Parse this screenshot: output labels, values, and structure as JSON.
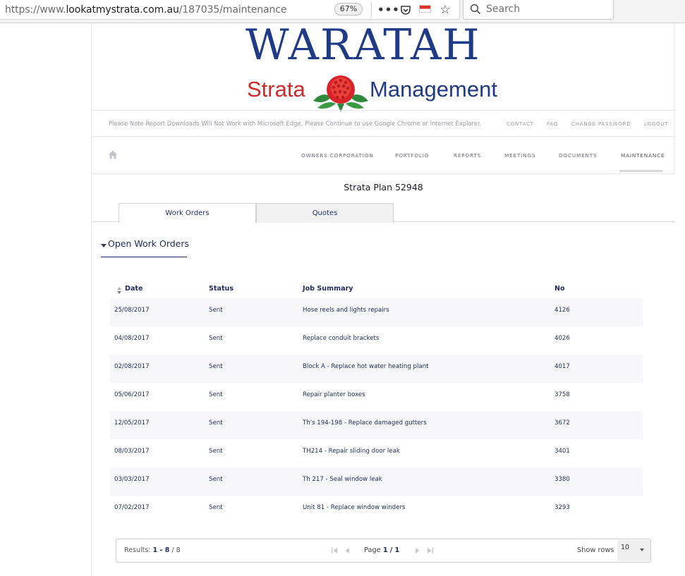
{
  "browser": {
    "url_prefix": "https://www.",
    "url_domain": "lookatmystrata.com.au",
    "url_path": "/187035/maintenance",
    "zoom": "67%",
    "more_glyph": "•••",
    "search_placeholder": "Search"
  },
  "logo": {
    "title": "WARATAH",
    "word_left": "Strata",
    "word_right": "Management"
  },
  "notice": "Please Note Report Downloads Will Not Work with Microsoft Edge, Please Continue to use Google Chrome or Internet Explorer.",
  "top_links": {
    "contact": "CONTACT",
    "faq": "FAQ",
    "change_password": "CHANGE PASSWORD",
    "logout": "LOGOUT"
  },
  "nav": {
    "owners_corporation": "OWNERS CORPORATION",
    "portfolio": "PORTFOLIO",
    "reports": "REPORTS",
    "meetings": "MEETINGS",
    "documents": "DOCUMENTS",
    "maintenance": "MAINTENANCE"
  },
  "strata_title": "Strata Plan 52948",
  "tabs": {
    "work_orders": "Work Orders",
    "quotes": "Quotes"
  },
  "section_title": "Open Work Orders",
  "table": {
    "headers": {
      "date": "Date",
      "status": "Status",
      "job_summary": "Job Summary",
      "no": "No"
    },
    "rows": [
      {
        "date": "25/08/2017",
        "status": "Sent",
        "job": "Hose reels and lights repairs",
        "no": "4126"
      },
      {
        "date": "04/08/2017",
        "status": "Sent",
        "job": "Replace conduit brackets",
        "no": "4026"
      },
      {
        "date": "02/08/2017",
        "status": "Sent",
        "job": "Block A - Replace hot water heating plant",
        "no": "4017"
      },
      {
        "date": "05/06/2017",
        "status": "Sent",
        "job": "Repair planter boxes",
        "no": "3758"
      },
      {
        "date": "12/05/2017",
        "status": "Sent",
        "job": "Th's 194-198 - Replace damaged gutters",
        "no": "3672"
      },
      {
        "date": "08/03/2017",
        "status": "Sent",
        "job": "TH214 - Repair sliding door leak",
        "no": "3401"
      },
      {
        "date": "03/03/2017",
        "status": "Sent",
        "job": "Th 217 - Seal window leak",
        "no": "3380"
      },
      {
        "date": "07/02/2017",
        "status": "Sent",
        "job": "Unit 81 - Replace window winders",
        "no": "3293"
      }
    ]
  },
  "pager": {
    "results_label": "Results:",
    "results_range": "1 - 8",
    "results_sep": "/",
    "results_total": "8",
    "page_label": "Page",
    "page_current": "1",
    "page_sep": "/",
    "page_total": "1",
    "show_rows_label": "Show rows",
    "rows_value": "10"
  },
  "colors": {
    "brand_blue": "#1f3b86",
    "brand_red": "#cf2a2a",
    "text_navy": "#1f2a5c"
  }
}
